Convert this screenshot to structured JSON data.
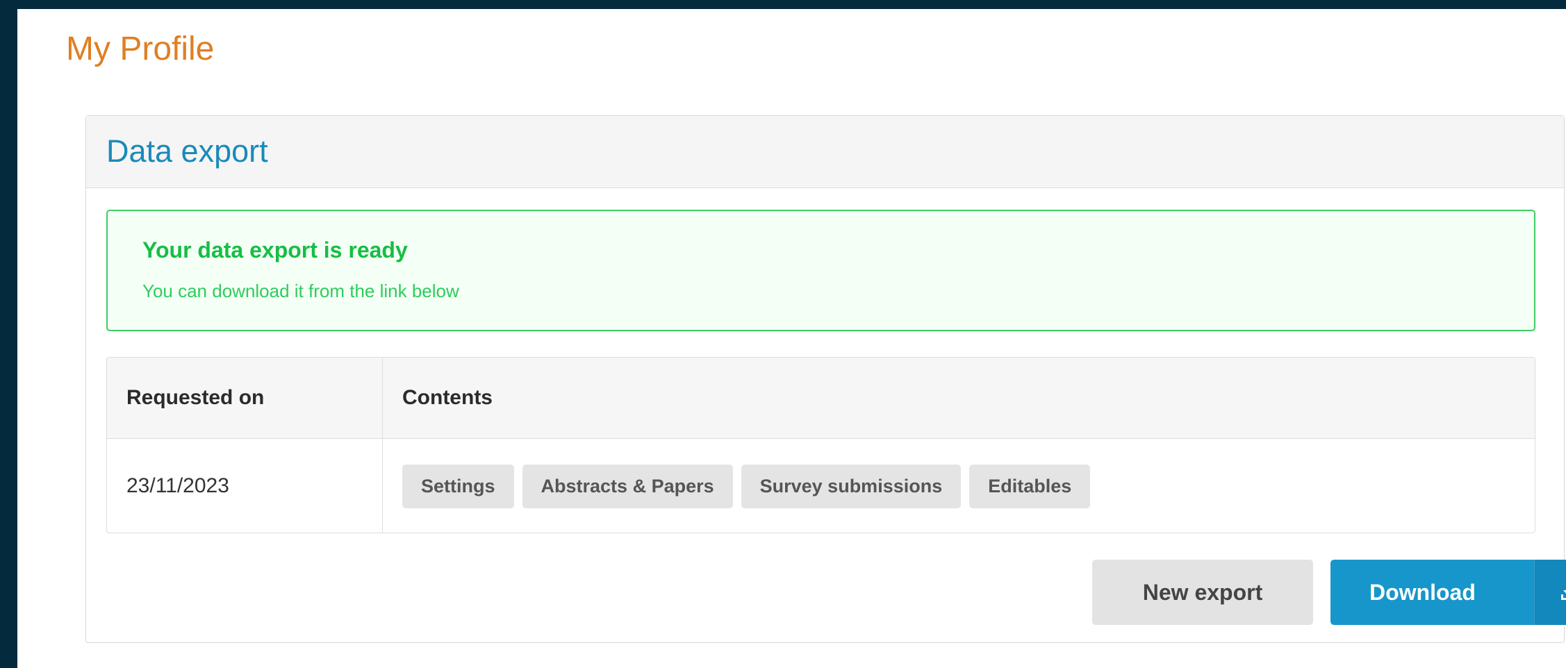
{
  "page": {
    "title": "My Profile"
  },
  "panel": {
    "title": "Data export"
  },
  "alert": {
    "title": "Your data export is ready",
    "message": "You can download it from the link below"
  },
  "table": {
    "headers": [
      "Requested on",
      "Contents"
    ],
    "rows": [
      {
        "requested_on": "23/11/2023",
        "contents": [
          "Settings",
          "Abstracts & Papers",
          "Survey submissions",
          "Editables"
        ]
      }
    ]
  },
  "actions": {
    "new_export_label": "New export",
    "download_label": "Download",
    "download_icon": "download-icon"
  },
  "colors": {
    "background": "#032b3d",
    "title": "#e07f22",
    "panel_title": "#1a8ab9",
    "success": "#16be45",
    "primary": "#1796cb"
  }
}
